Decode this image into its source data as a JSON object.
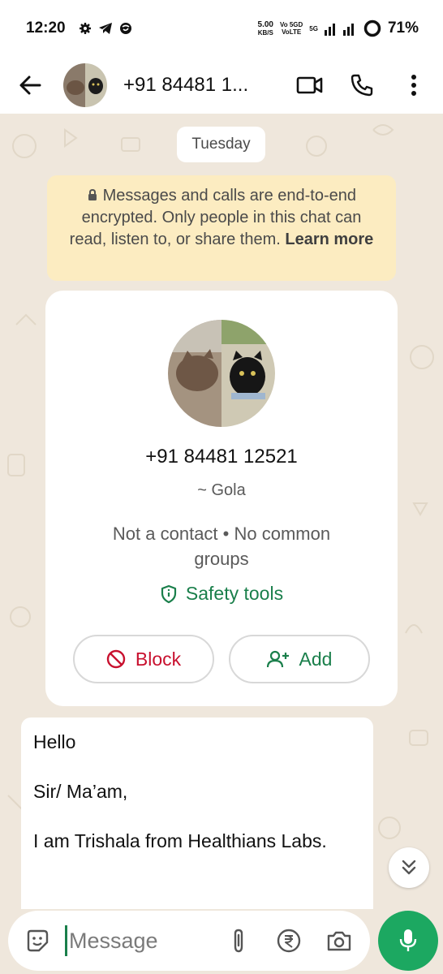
{
  "status_bar": {
    "time": "12:20",
    "net_speed_value": "5.00",
    "net_speed_unit": "KB/S",
    "net_tags_top": "Vo 5GD",
    "net_tags_bottom": "VoLTE",
    "network_label": "5G",
    "battery": "71%",
    "icons": [
      "settings-gear-icon",
      "telegram-icon",
      "vpn-icon",
      "signal-icon",
      "battery-icon"
    ]
  },
  "app_bar": {
    "title": "+91 84481 1...",
    "icons": [
      "back-arrow-icon",
      "video-call-icon",
      "voice-call-icon",
      "more-options-icon"
    ]
  },
  "chat": {
    "date_label": "Tuesday",
    "encryption_text": "Messages and calls are end-to-end encrypted. Only people in this chat can read, listen to, or share them.",
    "encryption_link": "Learn more"
  },
  "contact_card": {
    "phone": "+91 84481 12521",
    "name": "~ Gola",
    "meta": "Not a contact • No common groups",
    "safety_label": "Safety tools",
    "block_label": "Block",
    "add_label": "Add"
  },
  "message": {
    "lines": [
      "Hello",
      "Sir/ Ma’am,",
      "I am Trishala from Healthians Labs."
    ]
  },
  "composer": {
    "placeholder": "Message"
  },
  "colors": {
    "accent_green": "#1a7f4b",
    "mic_green": "#1ca861",
    "block_red": "#c8102e",
    "banner_yellow": "#fcecc1",
    "chat_background": "#efe7dc"
  }
}
